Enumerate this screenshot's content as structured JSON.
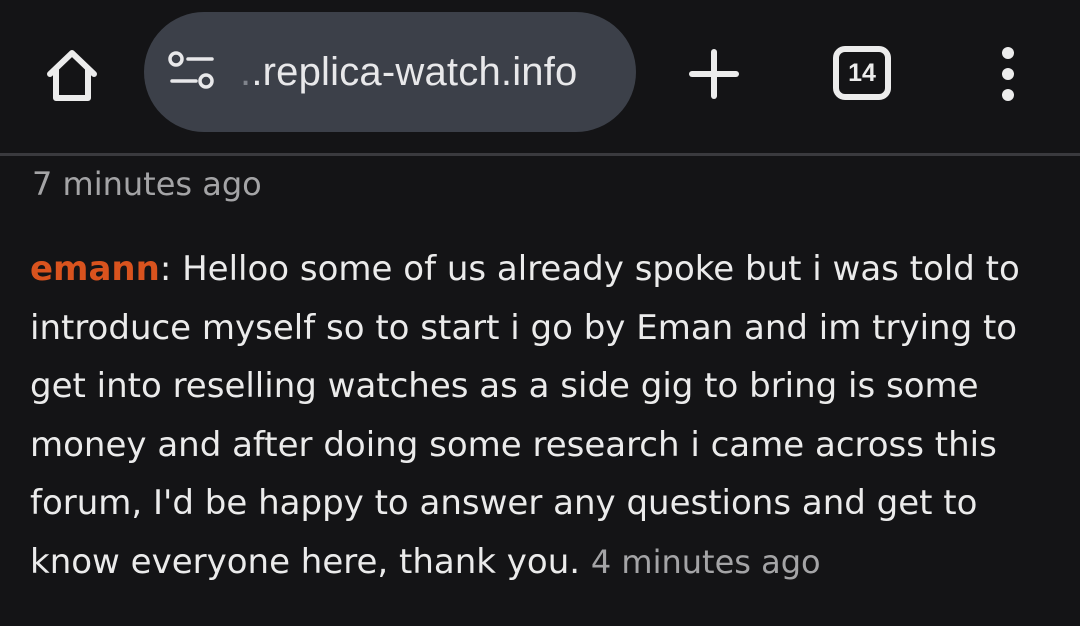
{
  "toolbar": {
    "home_icon": "home-icon",
    "site_info_icon": "tune-icon",
    "url_faded": ".",
    "url_domain": ".replica-watch.info",
    "new_tab_icon": "plus-icon",
    "tab_count": "14",
    "menu_icon": "more-vertical-icon"
  },
  "comment": {
    "timestamp_above": "7 minutes ago",
    "author": "emann",
    "separator": ":",
    "lines": [
      " Helloo some of us already spoke but i was told to",
      "introduce myself so to start i go by Eman and im trying to",
      "get into reselling watches as a side gig to bring is some",
      "money and after doing some research i came across this",
      "forum, I'd be happy to answer any questions and get to",
      "know everyone here, thank you."
    ],
    "timestamp": "4 minutes ago"
  },
  "colors": {
    "background": "#141416",
    "omnibox": "#3c4049",
    "author": "#d9531e",
    "timestamp": "#a4a4a6"
  }
}
